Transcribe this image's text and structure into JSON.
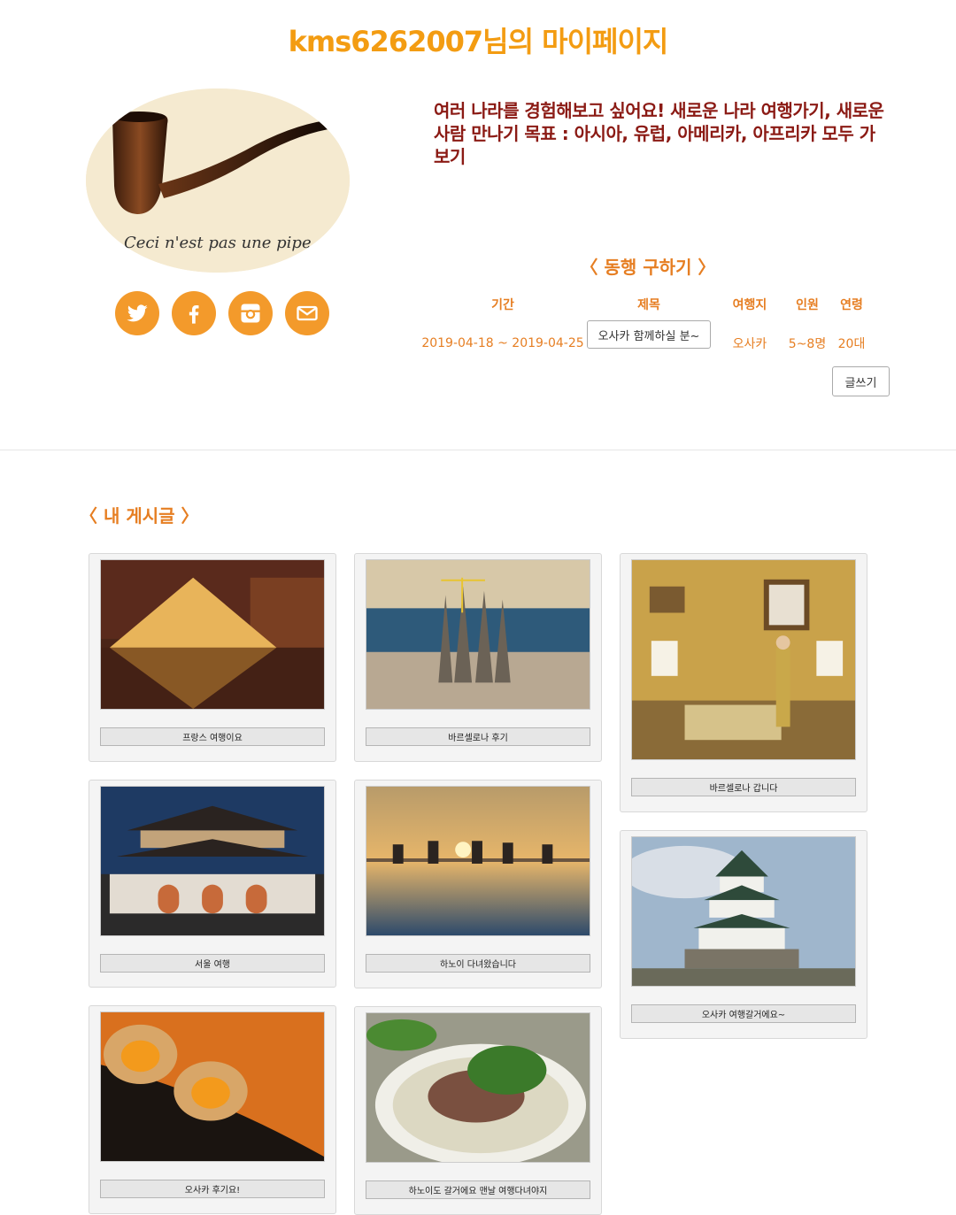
{
  "page_title": "kms6262007님의 마이페이지",
  "profile": {
    "image_alt": "Ceci n'est pas une pipe",
    "caption": "Ceci n'est pas une pipe"
  },
  "socials": [
    {
      "name": "twitter-icon"
    },
    {
      "name": "facebook-icon"
    },
    {
      "name": "instagram-icon"
    },
    {
      "name": "mail-icon"
    }
  ],
  "intro_text": "여러 나라를 경험해보고 싶어요! 새로운 나라 여행가기, 새로운 사람 만나기 목표 : 아시아, 유럽, 아메리카, 아프리카 모두 가보기",
  "companion": {
    "title": "〈 동행 구하기 〉",
    "headers": {
      "period": "기간",
      "title": "제목",
      "destination": "여행지",
      "people": "인원",
      "age": "연령"
    },
    "row": {
      "period": "2019-04-18 ~ 2019-04-25",
      "title": "오사카 함께하실 분~",
      "destination": "오사카",
      "people": "5~8명",
      "age": "20대"
    },
    "write_button": "글쓰기"
  },
  "my_posts": {
    "title": "〈 내 게시글 〉",
    "posts": [
      {
        "label": "프랑스 여행이요"
      },
      {
        "label": "바르셀로나 후기"
      },
      {
        "label": "바르셀로나 갑니다"
      },
      {
        "label": "서울 여행"
      },
      {
        "label": "하노이 다녀왔습니다"
      },
      {
        "label": "오사카 여행갈거에요~"
      },
      {
        "label": "오사카 후기요!"
      },
      {
        "label": "하노이도 갈거에요 맨날 여행다녀야지"
      }
    ]
  },
  "colors": {
    "title": "#f39c12",
    "accent": "#e67e22",
    "intro": "#8b1a14",
    "social": "#f39a2b"
  }
}
